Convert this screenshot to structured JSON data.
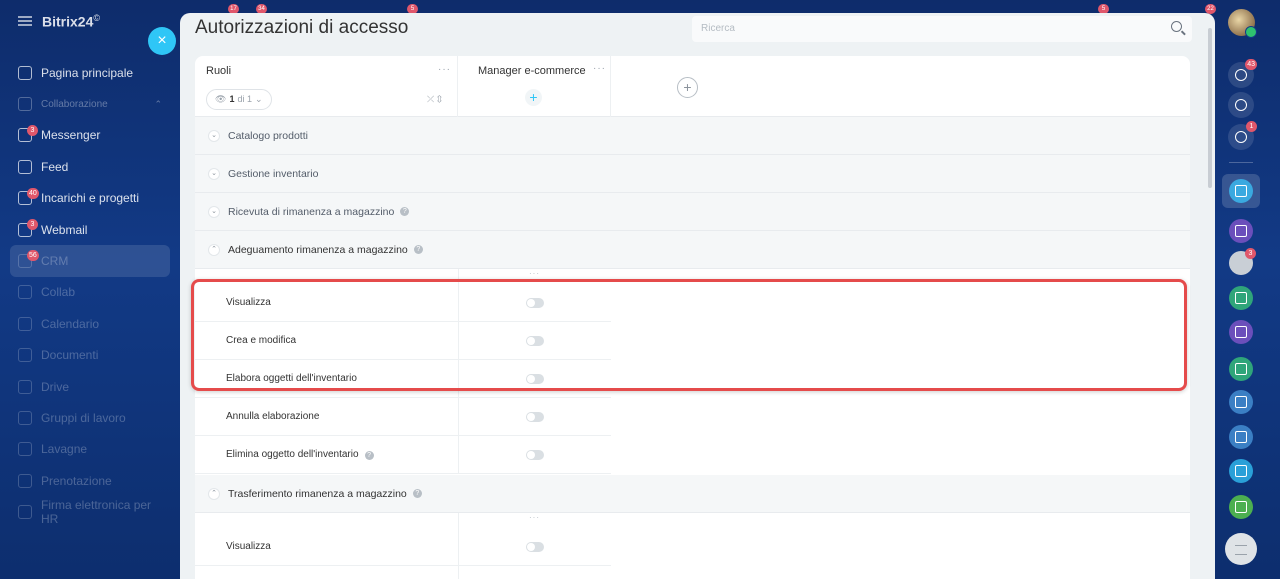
{
  "app": {
    "brand": "Bitrix24",
    "brand_suffix": "©"
  },
  "sidebar": {
    "items": [
      {
        "label": "Pagina principale",
        "icon": "home-icon"
      },
      {
        "label": "Collaborazione",
        "icon": "collab-icon"
      },
      {
        "label": "Messenger",
        "icon": "chat-icon",
        "badge": "3"
      },
      {
        "label": "Feed",
        "icon": "feed-icon"
      },
      {
        "label": "Incarichi e progetti",
        "icon": "tasks-icon",
        "badge": "40"
      },
      {
        "label": "Webmail",
        "icon": "mail-icon",
        "badge": "3"
      },
      {
        "label": "CRM",
        "icon": "crm-icon",
        "badge": "56"
      },
      {
        "label": "Collab",
        "icon": "collab-circle-icon"
      },
      {
        "label": "Calendario",
        "icon": "calendar-icon"
      },
      {
        "label": "Documenti",
        "icon": "documents-icon"
      },
      {
        "label": "Drive",
        "icon": "drive-icon"
      },
      {
        "label": "Gruppi di lavoro",
        "icon": "groups-icon"
      },
      {
        "label": "Lavagne",
        "icon": "boards-icon"
      },
      {
        "label": "Prenotazione",
        "icon": "booking-icon"
      },
      {
        "label": "Firma elettronica per HR",
        "icon": "signature-icon"
      }
    ]
  },
  "panel": {
    "title": "Autorizzazioni di accesso",
    "search_placeholder": "Ricerca",
    "close_label": "×"
  },
  "grid": {
    "roles_label": "Ruoli",
    "pager": {
      "current": "1",
      "of_label": "di 1"
    },
    "role_column": "Manager e-commerce",
    "add_label": "+",
    "more_label": "···"
  },
  "sections": [
    {
      "label": "Catalogo prodotti",
      "chevron": "⌄"
    },
    {
      "label": "Gestione inventario",
      "chevron": "⌄"
    },
    {
      "label": "Ricevuta di rimanenza a magazzino",
      "chevron": "⌄",
      "help": "?"
    },
    {
      "label": "Adeguamento rimanenza a magazzino",
      "chevron": "⌃",
      "help": "?"
    },
    {
      "label": "Trasferimento rimanenza a magazzino",
      "chevron": "⌃",
      "help": "?"
    }
  ],
  "rows_adjustment": [
    {
      "label": "Visualizza",
      "enabled": false
    },
    {
      "label": "Crea e modifica",
      "enabled": false
    },
    {
      "label": "Elabora oggetti dell'inventario",
      "enabled": false
    },
    {
      "label": "Annulla elaborazione",
      "enabled": false
    },
    {
      "label": "Elimina oggetto dell'inventario",
      "enabled": false,
      "help": "?"
    }
  ],
  "rows_transfer": [
    {
      "label": "Visualizza",
      "enabled": false
    }
  ],
  "rightbar": {
    "badges": {
      "notifications": "43",
      "chat": "1",
      "avatar2": "3"
    }
  },
  "topbar_badges": [
    "17",
    "34",
    "5",
    "5",
    "22"
  ],
  "colors": {
    "accent": "#2fc6f6",
    "highlight": "#e54b4b",
    "badge": "#e0576b"
  }
}
